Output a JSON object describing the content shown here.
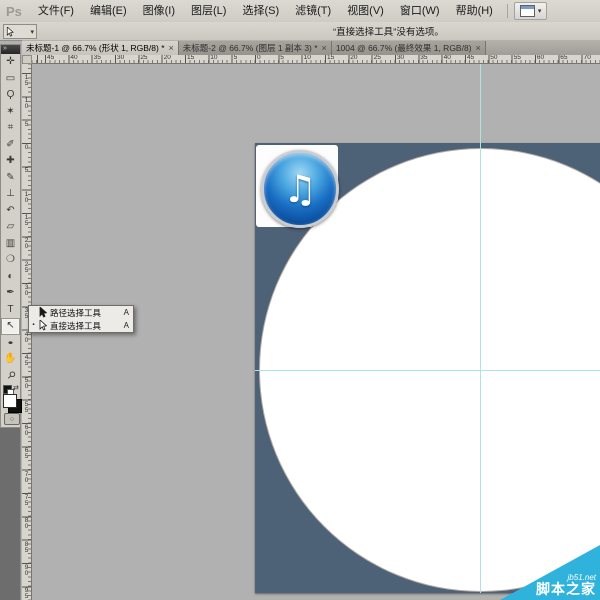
{
  "app": {
    "logo": "Ps"
  },
  "menu": {
    "items": [
      "文件(F)",
      "编辑(E)",
      "图像(I)",
      "图层(L)",
      "选择(S)",
      "滤镜(T)",
      "视图(V)",
      "窗口(W)",
      "帮助(H)"
    ]
  },
  "options_bar": {
    "active_tool": "直接选择工具",
    "status": "“直接选择工具”没有选项。",
    "dropdown_caret": "▾"
  },
  "tabs": [
    {
      "label": "未标题-1 @ 66.7% (形状 1, RGB/8) *",
      "close": "×",
      "active": true
    },
    {
      "label": "未标题-2 @ 66.7% (图层 1 副本 3) *",
      "close": "×",
      "active": false
    },
    {
      "label": "1004 @ 66.7% (最终效果 1, RGB/8)",
      "close": "×",
      "active": false
    }
  ],
  "rulers": {
    "horizontal": [
      "45",
      "40",
      "35",
      "30",
      "25",
      "20",
      "15",
      "10",
      "5",
      "0",
      "5",
      "10",
      "15",
      "20",
      "25",
      "30",
      "35",
      "40",
      "45",
      "50",
      "55",
      "60",
      "65",
      "70"
    ],
    "vertical": [
      "15",
      "10",
      "5",
      "0",
      "5",
      "10",
      "15",
      "20",
      "25",
      "30",
      "35",
      "40",
      "45",
      "50",
      "55",
      "60",
      "65",
      "70",
      "75",
      "80",
      "85",
      "90",
      "95"
    ]
  },
  "toolbar": {
    "header_glyph": "»",
    "tools": [
      {
        "name": "move-tool",
        "glyph": "✛"
      },
      {
        "name": "rectangular-marquee-tool",
        "glyph": "▭"
      },
      {
        "name": "lasso-tool",
        "glyph": "Ϙ"
      },
      {
        "name": "quick-selection-tool",
        "glyph": "✶"
      },
      {
        "name": "crop-tool",
        "glyph": "⌗"
      },
      {
        "name": "eyedropper-tool",
        "glyph": "✐"
      },
      {
        "name": "healing-brush-tool",
        "glyph": "✚"
      },
      {
        "name": "brush-tool",
        "glyph": "✎"
      },
      {
        "name": "clone-stamp-tool",
        "glyph": "⊥"
      },
      {
        "name": "history-brush-tool",
        "glyph": "↶"
      },
      {
        "name": "eraser-tool",
        "glyph": "▱"
      },
      {
        "name": "gradient-tool",
        "glyph": "▥"
      },
      {
        "name": "blur-tool",
        "glyph": "❍"
      },
      {
        "name": "dodge-tool",
        "glyph": "◐"
      },
      {
        "name": "pen-tool",
        "glyph": "✒"
      },
      {
        "name": "type-tool",
        "glyph": "T"
      },
      {
        "name": "path-selection-tool",
        "glyph": "↖",
        "active": true
      },
      {
        "name": "ellipse-tool",
        "glyph": "●"
      },
      {
        "name": "hand-tool",
        "glyph": "✋"
      },
      {
        "name": "zoom-tool",
        "glyph": "⚲"
      }
    ],
    "quickmask_glyph": "○"
  },
  "flyout": {
    "items": [
      {
        "icon": "path-selection-black-arrow-icon",
        "label": "路径选择工具",
        "shortcut": "A",
        "selected": false
      },
      {
        "icon": "direct-selection-white-arrow-icon",
        "label": "直接选择工具",
        "shortcut": "A",
        "selected": true
      }
    ],
    "selected_bullet": "▪"
  },
  "canvas": {
    "zoom_percent": "66.7%",
    "background_color": "#4d6177",
    "circle_color": "#ffffff",
    "guide_color": "#aee3df",
    "itunes_note": "♫"
  },
  "watermark": {
    "site": "jb51.net",
    "name": "脚本之家",
    "color": "#2fb3dc"
  }
}
